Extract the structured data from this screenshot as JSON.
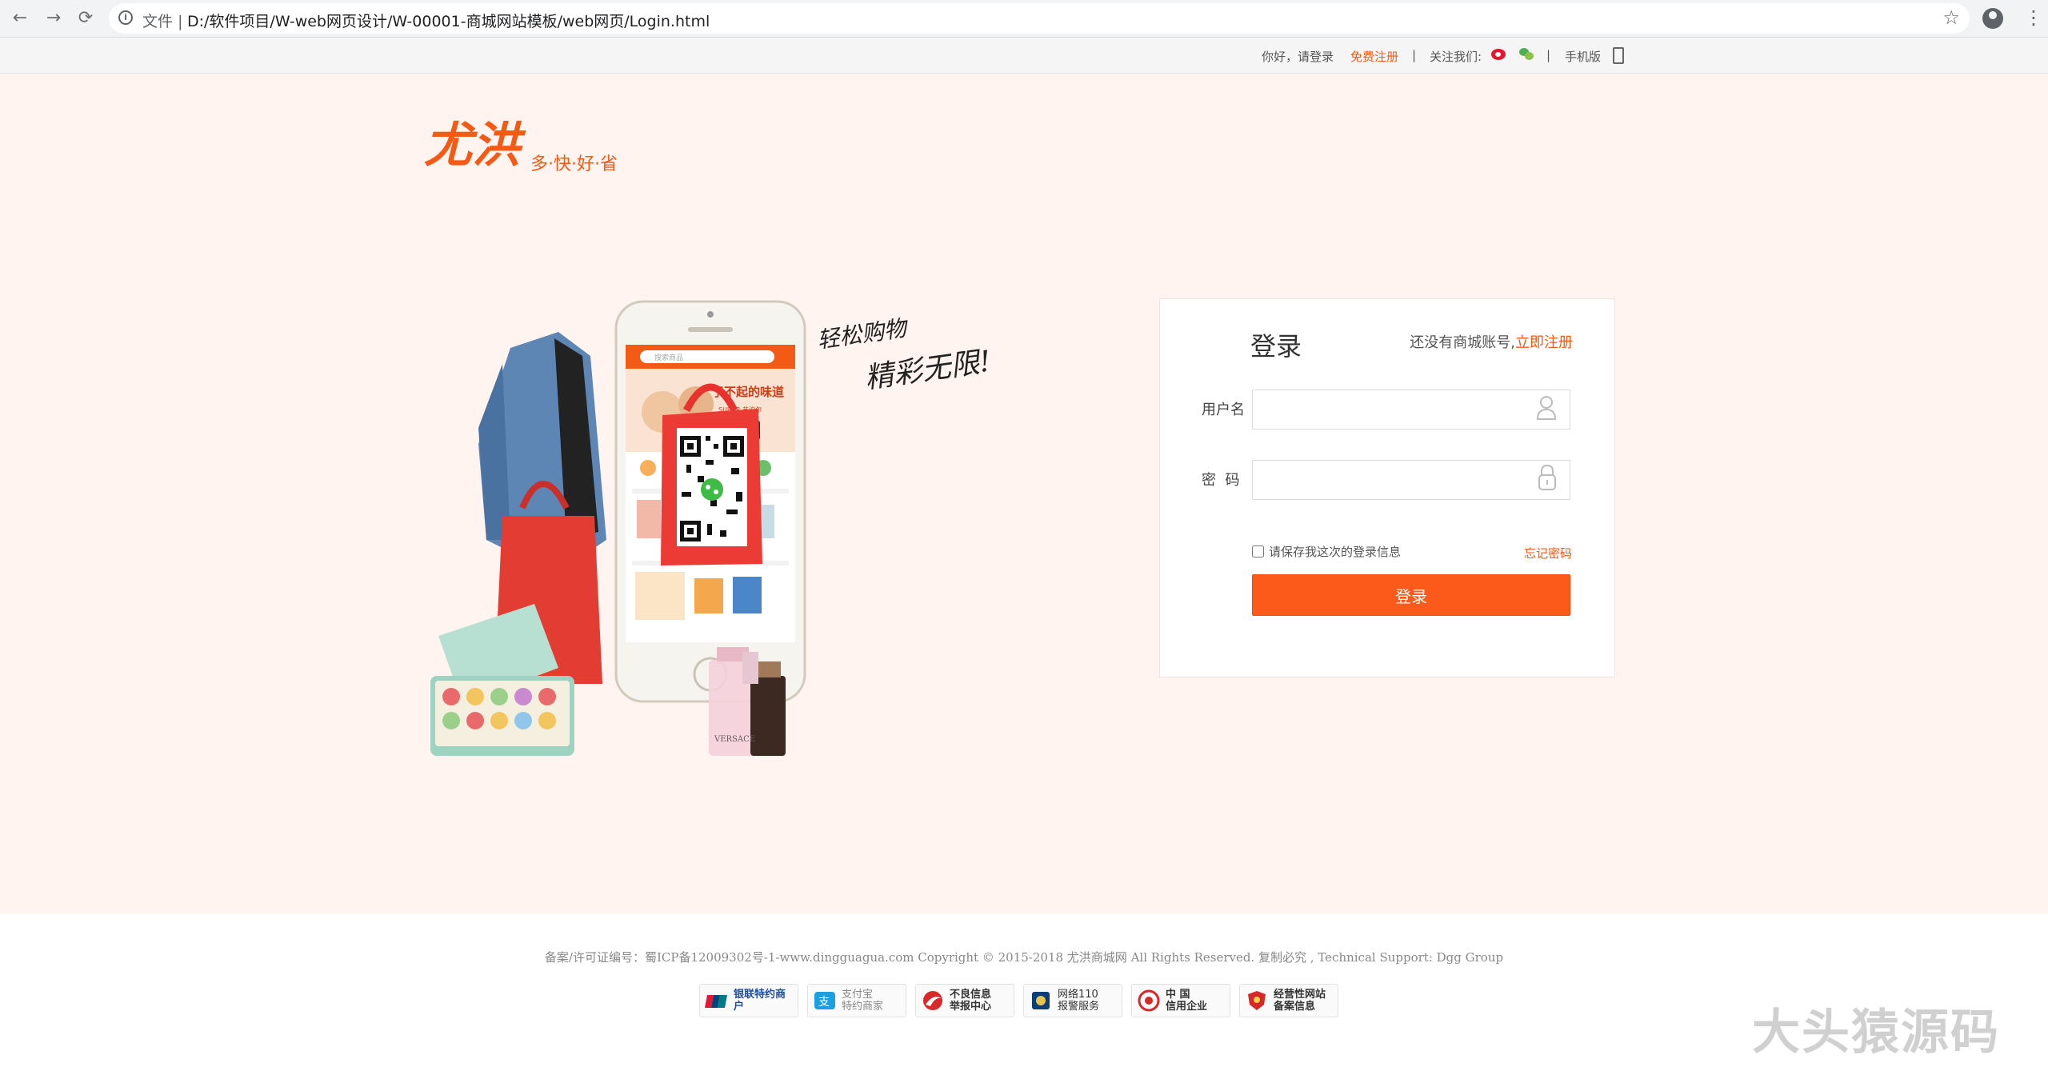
{
  "browser": {
    "scheme_label": "文件",
    "separator": "|",
    "url": "D:/软件项目/W-web网页设计/W-00001-商城网站模板/web网页/Login.html",
    "back_glyph": "←",
    "forward_glyph": "→",
    "reload_glyph": "⟳",
    "star_glyph": "☆",
    "menu_glyph": "⋮"
  },
  "topbar": {
    "greeting": "你好，请登录",
    "register": "免费注册",
    "sep": "|",
    "follow": "关注我们:",
    "sep2": "|",
    "mobile": "手机版"
  },
  "logo": {
    "brand": "尤洪",
    "slogan": "多·快·好·省"
  },
  "promo": {
    "slogan_line1": "轻松购物",
    "slogan_line2": "精彩无限!",
    "phone_banner": "了不起的味道",
    "phone_banner_sub": "SUPOR 苏泊尔",
    "search_placeholder": "搜索商品",
    "perfume_brand": "VERSACE"
  },
  "login": {
    "title": "登录",
    "no_account": "还没有商城账号,",
    "register_link": "立即注册",
    "username_label": "用户名",
    "password_label": "密  码",
    "username_value": "",
    "password_value": "",
    "remember_label": "请保存我这次的登录信息",
    "remember_checked": false,
    "forgot_link": "忘记密码",
    "submit_label": "登录"
  },
  "footer": {
    "copyright": "备案/许可证编号：蜀ICP备12009302号-1-www.dingguagua.com Copyright © 2015-2018 尤洪商城网 All Rights Reserved. 复制必究 , Technical Support: Dgg Group",
    "badges": [
      {
        "text": "银联特约商户"
      },
      {
        "text": "支付宝\n特约商家"
      },
      {
        "text": "不良信息\n举报中心"
      },
      {
        "text": "网络110\n报警服务"
      },
      {
        "text": "中 国\n信用企业"
      },
      {
        "text": "经营性网站\n备案信息"
      }
    ]
  },
  "watermark": "大头猿源码",
  "colors": {
    "accent": "#f35a15",
    "button": "#fb5a1a",
    "page_bg": "#fff4f0"
  }
}
